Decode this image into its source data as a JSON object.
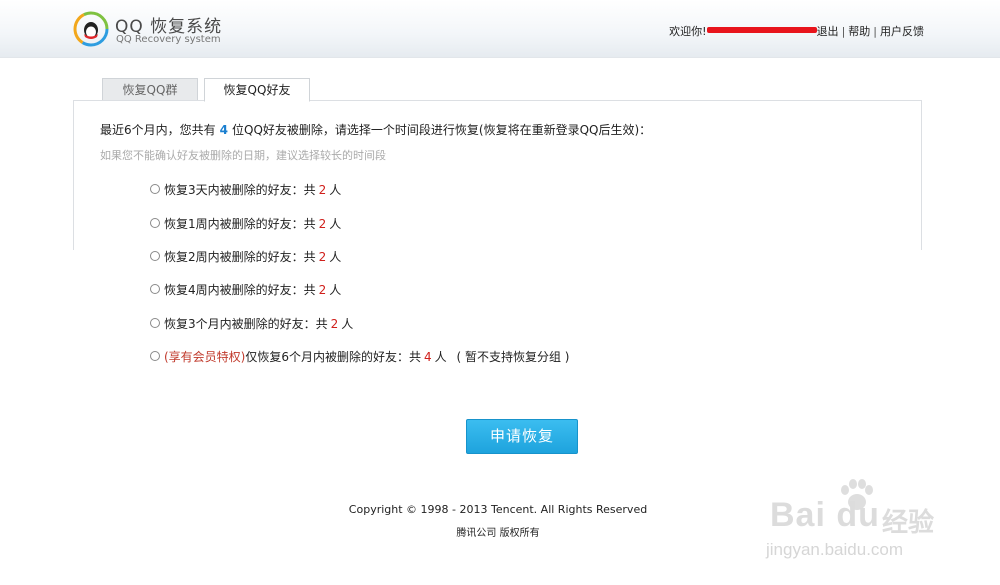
{
  "header": {
    "logo_title": "QQ 恢复系统",
    "logo_subtitle": "QQ Recovery system",
    "welcome": "欢迎你!",
    "logout": "退出",
    "separator": "|",
    "help": "帮助",
    "feedback": "用户反馈"
  },
  "tabs": [
    {
      "label": "恢复QQ群",
      "active": false
    },
    {
      "label": "恢复QQ好友",
      "active": true
    }
  ],
  "intro": {
    "before": "最近6个月内，您共有",
    "count": "4",
    "after": "位QQ好友被删除，请选择一个时间段进行恢复(恢复将在重新登录QQ后生效)："
  },
  "hint": "如果您不能确认好友被删除的日期，建议选择较长的时间段",
  "options": [
    {
      "label": "恢复3天内被删除的好友：共",
      "count": "2",
      "unit": "人"
    },
    {
      "label": "恢复1周内被删除的好友：共",
      "count": "2",
      "unit": "人"
    },
    {
      "label": "恢复2周内被删除的好友：共",
      "count": "2",
      "unit": "人"
    },
    {
      "label": "恢复4周内被删除的好友：共",
      "count": "2",
      "unit": "人"
    },
    {
      "label": "恢复3个月内被删除的好友：共",
      "count": "2",
      "unit": "人"
    },
    {
      "vip": "(享有会员特权)",
      "label": "仅恢复6个月内被删除的好友：共",
      "count": "4",
      "unit": "人",
      "note": "( 暂不支持恢复分组 )"
    }
  ],
  "apply_button": "申请恢复",
  "footer": {
    "copyright": "Copyright © 1998 - 2013 Tencent. All Rights Reserved",
    "company": "腾讯公司 版权所有"
  },
  "watermark": {
    "brand": "Bai du",
    "brand_cn": "经验",
    "url": "jingyan.baidu.com"
  },
  "colors": {
    "accent_blue": "#1a7fd0",
    "count_red": "#d0201c",
    "button_blue": "#2aaee6",
    "redaction": "#e8141c"
  }
}
